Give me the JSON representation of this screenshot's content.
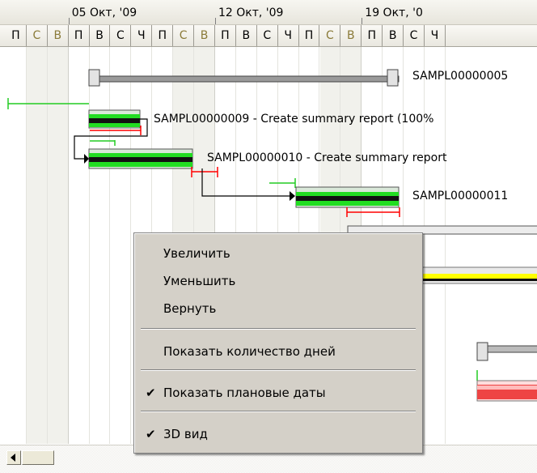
{
  "timeline": {
    "weeks": [
      "05 Окт, '09",
      "12 Окт, '09",
      "19 Окт, '0"
    ],
    "days": [
      "П",
      "С",
      "В",
      "П",
      "В",
      "С",
      "Ч",
      "П",
      "С",
      "В",
      "П",
      "В",
      "С",
      "Ч",
      "П",
      "С",
      "В",
      "П",
      "В",
      "С",
      "Ч"
    ],
    "weekend_indices": [
      1,
      2,
      8,
      9,
      15,
      16
    ]
  },
  "tasks": [
    {
      "label": "SAMPL00000005"
    },
    {
      "label": "SAMPL00000009 - Create summary report (100%"
    },
    {
      "label": "SAMPL00000010 - Create summary report"
    },
    {
      "label": "SAMPL00000011"
    }
  ],
  "context_menu": {
    "items": [
      {
        "label": "Увеличить",
        "checked": false
      },
      {
        "label": "Уменьшить",
        "checked": false
      },
      {
        "label": "Вернуть",
        "checked": false
      },
      {
        "label": "Показать количество дней",
        "checked": false
      },
      {
        "label": "Показать плановые даты",
        "checked": true
      },
      {
        "label": "3D вид",
        "checked": true
      }
    ],
    "check_glyph": "✔"
  },
  "colors": {
    "progress_green": "#22dd22",
    "baseline_red": "#ff0000",
    "summary_yellow": "#ffff00",
    "critical_red": "#ee4444"
  }
}
